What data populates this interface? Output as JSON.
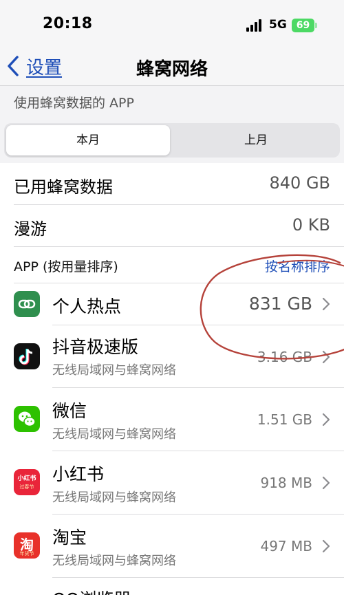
{
  "status_bar": {
    "time": "20:18",
    "network": "5G",
    "battery": "69",
    "battery_color": "#4cd964"
  },
  "nav": {
    "back_label": "设置",
    "title": "蜂窝网络",
    "accent_color": "#1f4fb8"
  },
  "subhead": "使用蜂窝数据的 APP",
  "segments": {
    "selected": "本月",
    "other": "上月"
  },
  "summary": [
    {
      "label": "已用蜂窝数据",
      "value": "840 GB"
    },
    {
      "label": "漫游",
      "value": "0 KB"
    }
  ],
  "app_section": {
    "label": "APP (按用量排序)",
    "sort_link": "按名称排序"
  },
  "apps": [
    {
      "name": "个人热点",
      "subtitle": "",
      "usage": "831 GB",
      "icon": "hotspot-icon"
    },
    {
      "name": "抖音极速版",
      "subtitle": "无线局域网与蜂窝网络",
      "usage": "3.16 GB",
      "icon": "douyin-icon"
    },
    {
      "name": "微信",
      "subtitle": "无线局域网与蜂窝网络",
      "usage": "1.51 GB",
      "icon": "wechat-icon"
    },
    {
      "name": "小红书",
      "subtitle": "无线局域网与蜂窝网络",
      "usage": "918 MB",
      "icon": "xiaohongshu-icon",
      "icon_text": "小红书",
      "icon_subtext": "过春节"
    },
    {
      "name": "淘宝",
      "subtitle": "无线局域网与蜂窝网络",
      "usage": "497 MB",
      "icon": "taobao-icon",
      "icon_text": "淘",
      "icon_subtext": "年货节"
    },
    {
      "name": "QQ浏览器",
      "subtitle": "",
      "usage": "",
      "icon": "qq-browser-icon"
    }
  ],
  "annotation_color": "#b5423a"
}
